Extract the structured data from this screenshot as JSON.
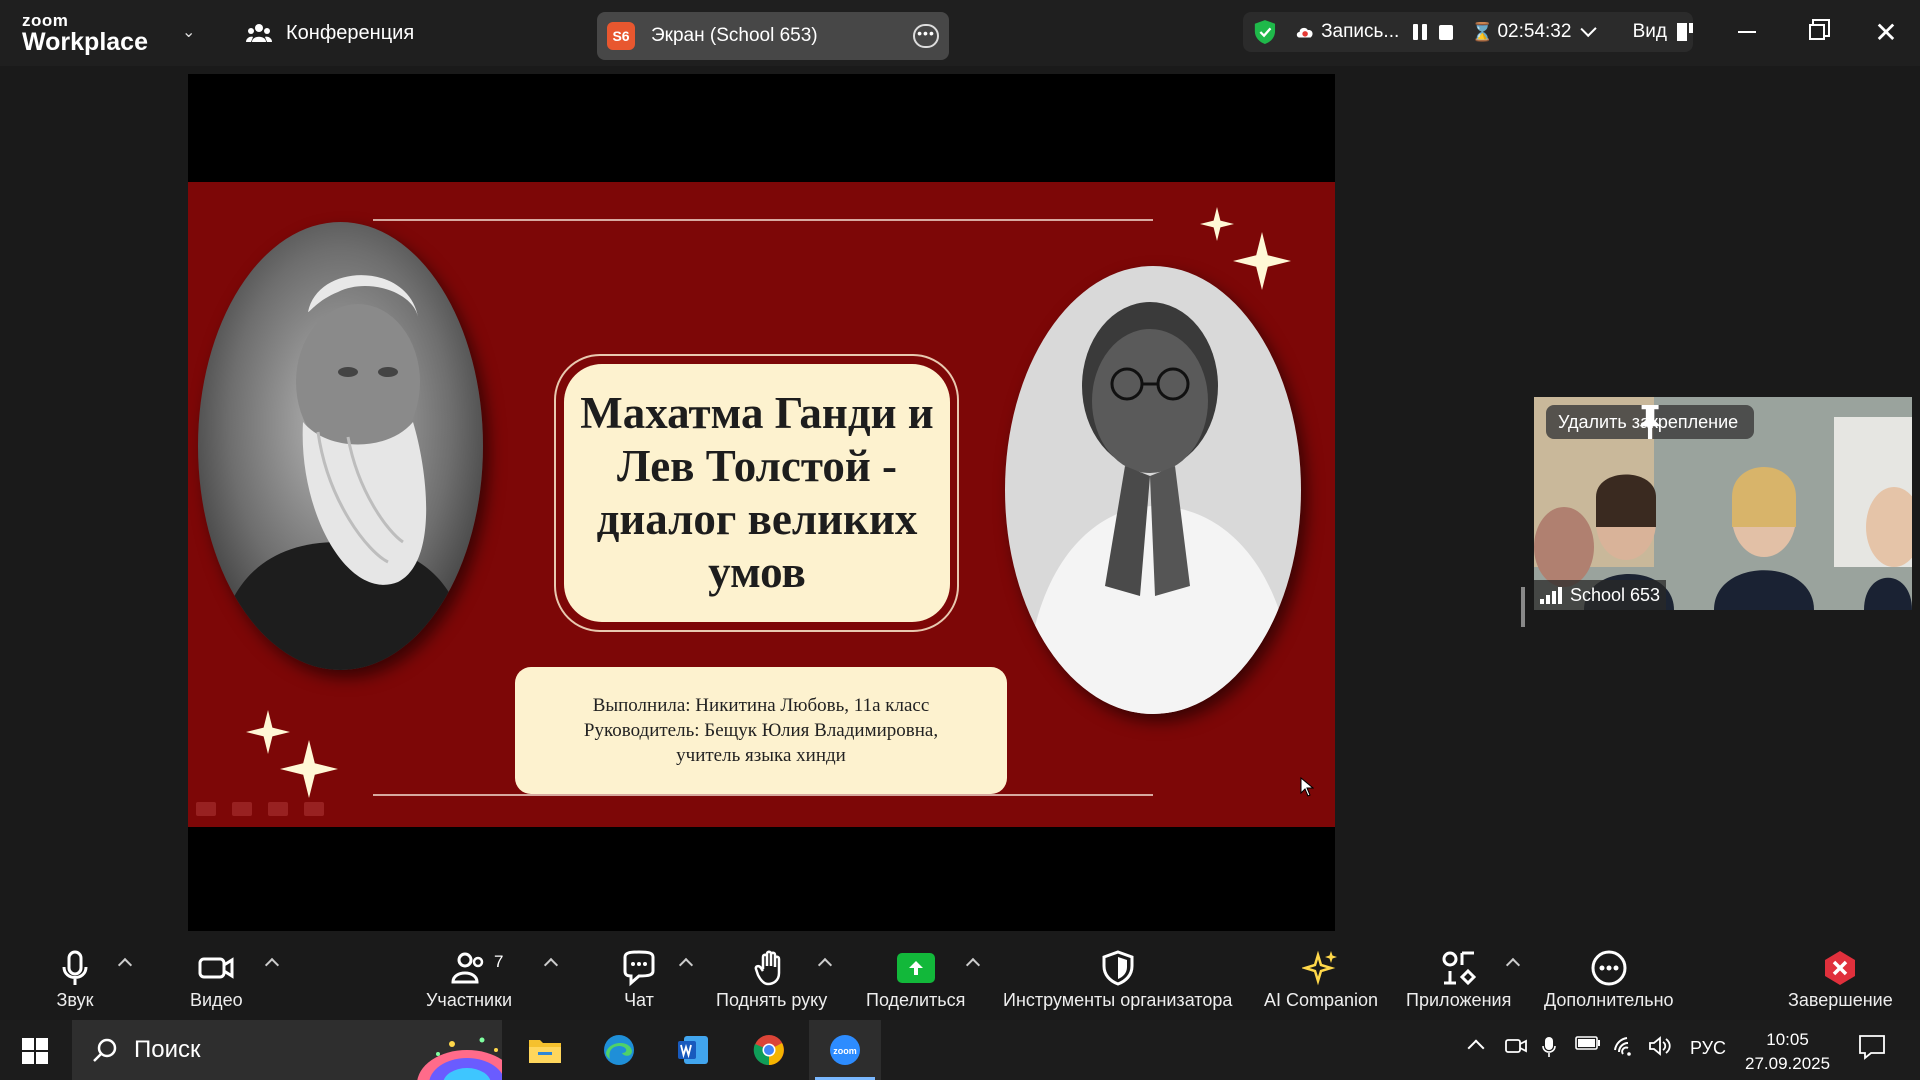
{
  "app": {
    "logo_top": "zoom",
    "logo_bottom": "Workplace",
    "conference_label": "Конференция"
  },
  "screen_share": {
    "avatar_text": "S6",
    "title": "Экран (School 653)",
    "avatar_color": "#e8572f"
  },
  "recording": {
    "label": "Запись...",
    "timer": "02:54:32",
    "view_label": "Вид"
  },
  "slide": {
    "title": "Махатма Ганди и Лев Толстой - диалог великих умов",
    "credit_line1": "Выполнила:  Никитина  Любовь, 11а  класс",
    "credit_line2": "Руководитель:  Бещук  Юлия  Владимировна,",
    "credit_line3": "учитель  языка  хинди",
    "background_color": "#7d0707"
  },
  "pinned_video": {
    "unpin_label": "Удалить закрепление",
    "participant_name": "School 653"
  },
  "toolbar": {
    "audio": "Звук",
    "video": "Видео",
    "participants": "Участники",
    "participants_count": "7",
    "chat": "Чат",
    "raise_hand": "Поднять руку",
    "share": "Поделиться",
    "host_tools": "Инструменты организатора",
    "ai_companion": "AI Companion",
    "apps": "Приложения",
    "more": "Дополнительно",
    "end": "Завершение",
    "share_color": "#12b83a",
    "end_color": "#e0303c"
  },
  "taskbar": {
    "search_placeholder": "Поиск",
    "language": "РУС",
    "time": "10:05",
    "date": "27.09.2025"
  }
}
